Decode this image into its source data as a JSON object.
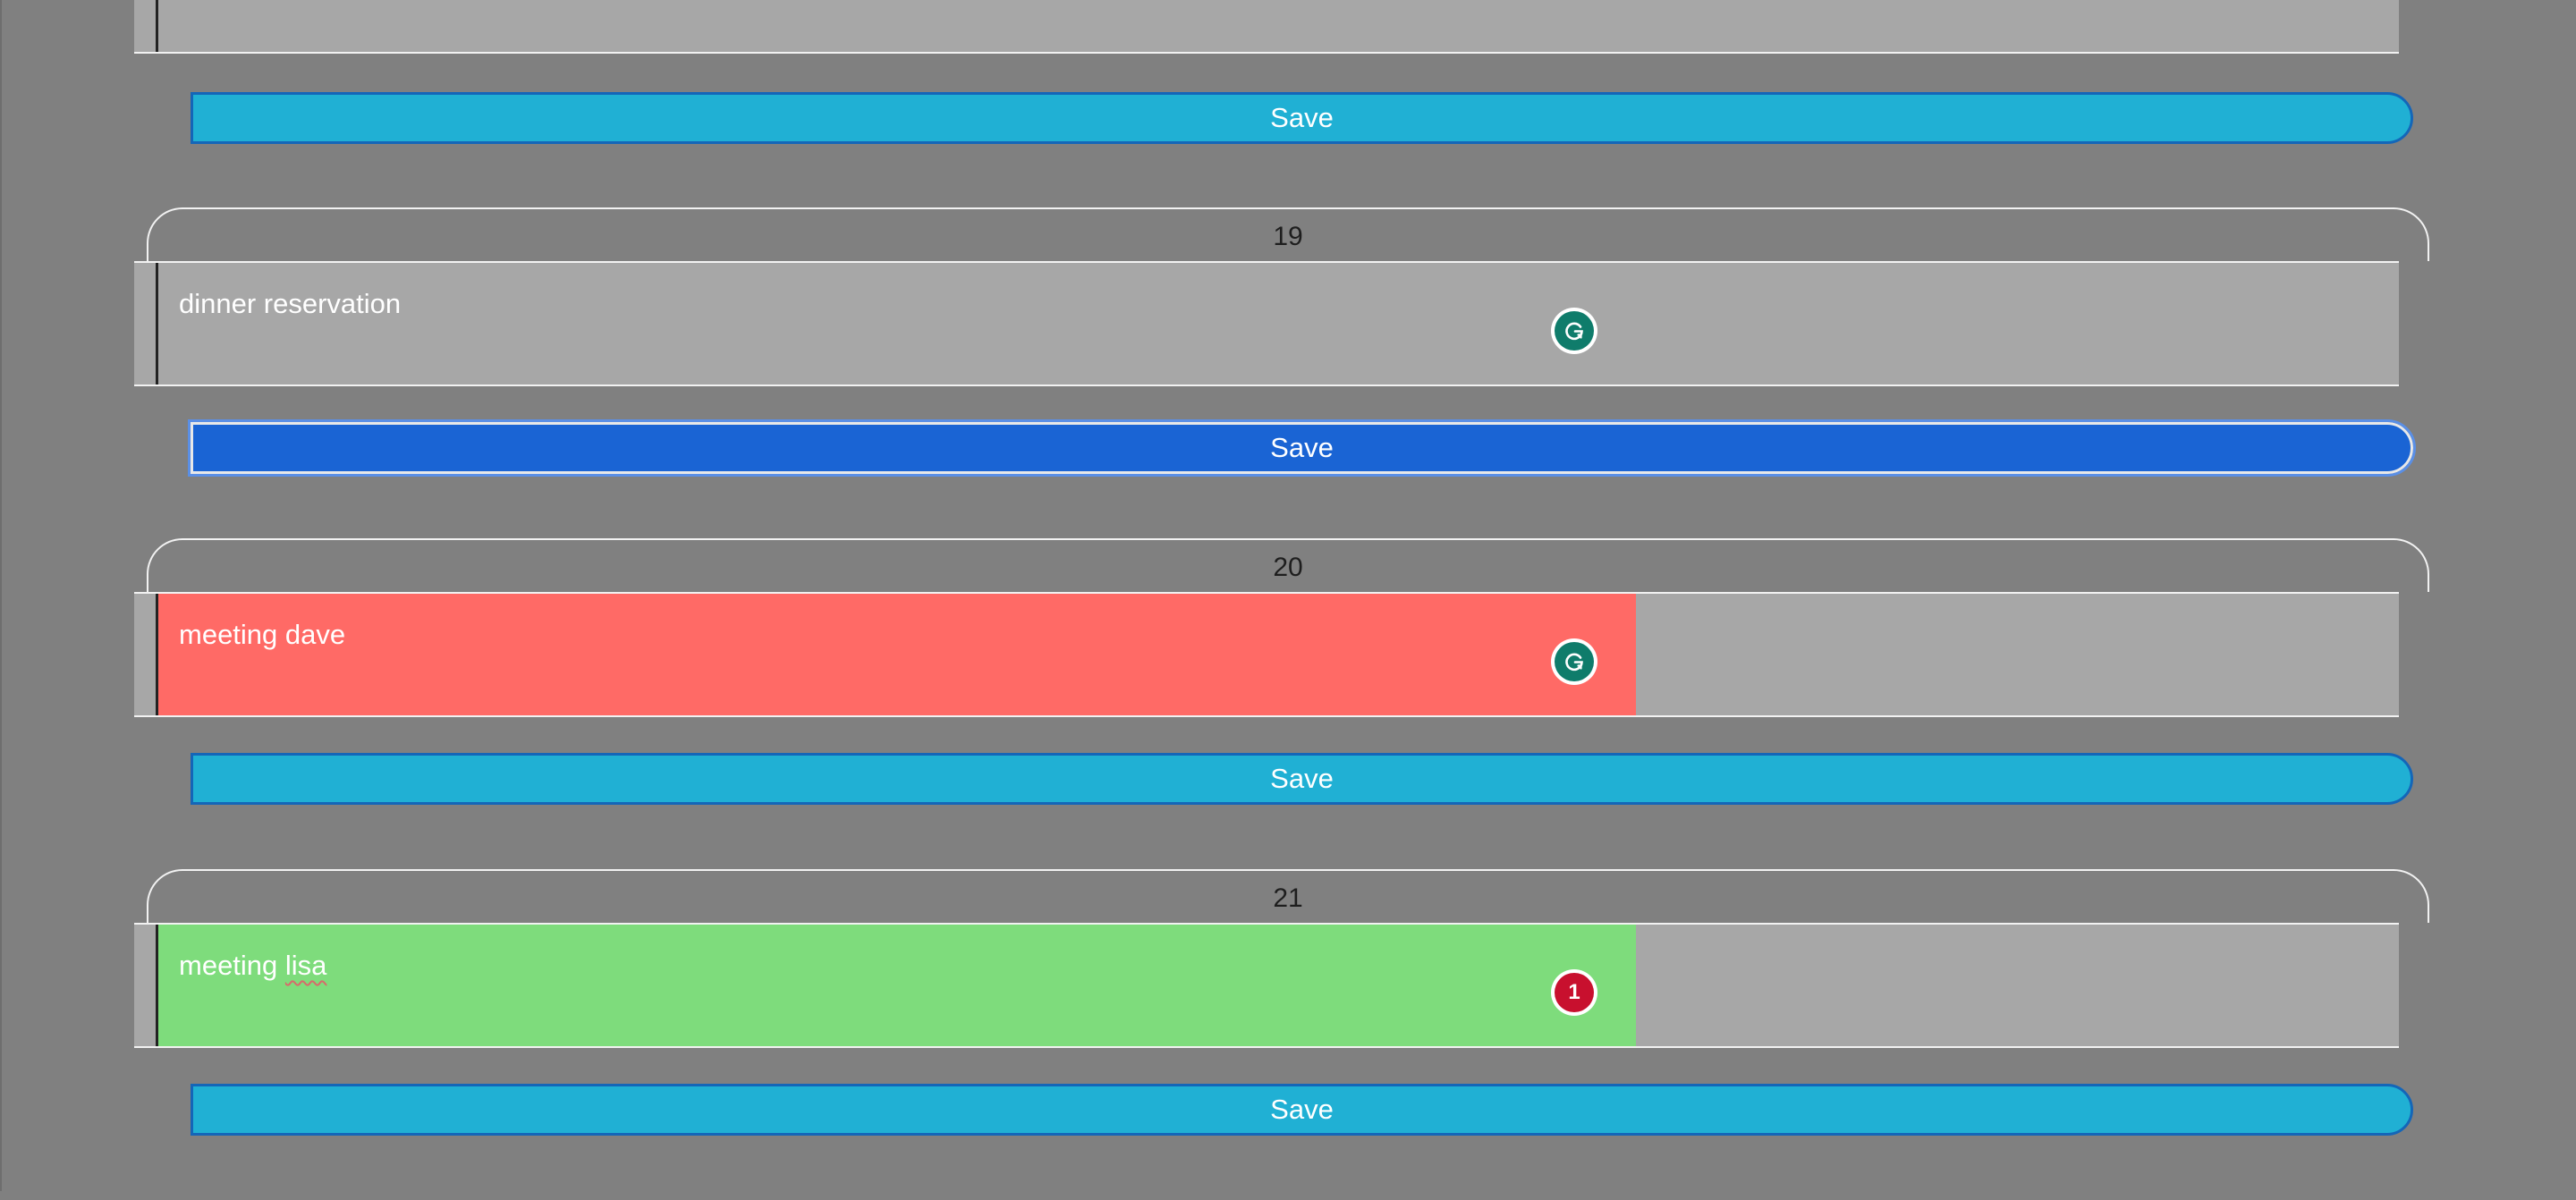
{
  "save_label": "Save",
  "colors": {
    "background": "#808080",
    "entry_background": "#a7a7a7",
    "save_button": "#20b0d4",
    "save_button_active": "#1a64d4",
    "entry_red": "#ff6a66",
    "entry_green": "#7edc7c",
    "grammar_badge": "#0f7c6b",
    "issue_badge": "#c8102e"
  },
  "days": [
    {
      "number": "19",
      "entry_text": "dinner reservation",
      "entry_color": null,
      "badge": {
        "type": "grammar",
        "icon": "grammarly-icon"
      },
      "save_active": true
    },
    {
      "number": "20",
      "entry_text": "meeting dave",
      "entry_color": "#ff6a66",
      "badge": {
        "type": "grammar",
        "icon": "grammarly-icon"
      },
      "save_active": false
    },
    {
      "number": "21",
      "entry_text_prefix": "meeting ",
      "entry_text_misspelled": "lisa",
      "entry_color": "#7edc7c",
      "badge": {
        "type": "issues",
        "icon": "issue-count-badge",
        "count": "1"
      },
      "save_active": false
    }
  ]
}
